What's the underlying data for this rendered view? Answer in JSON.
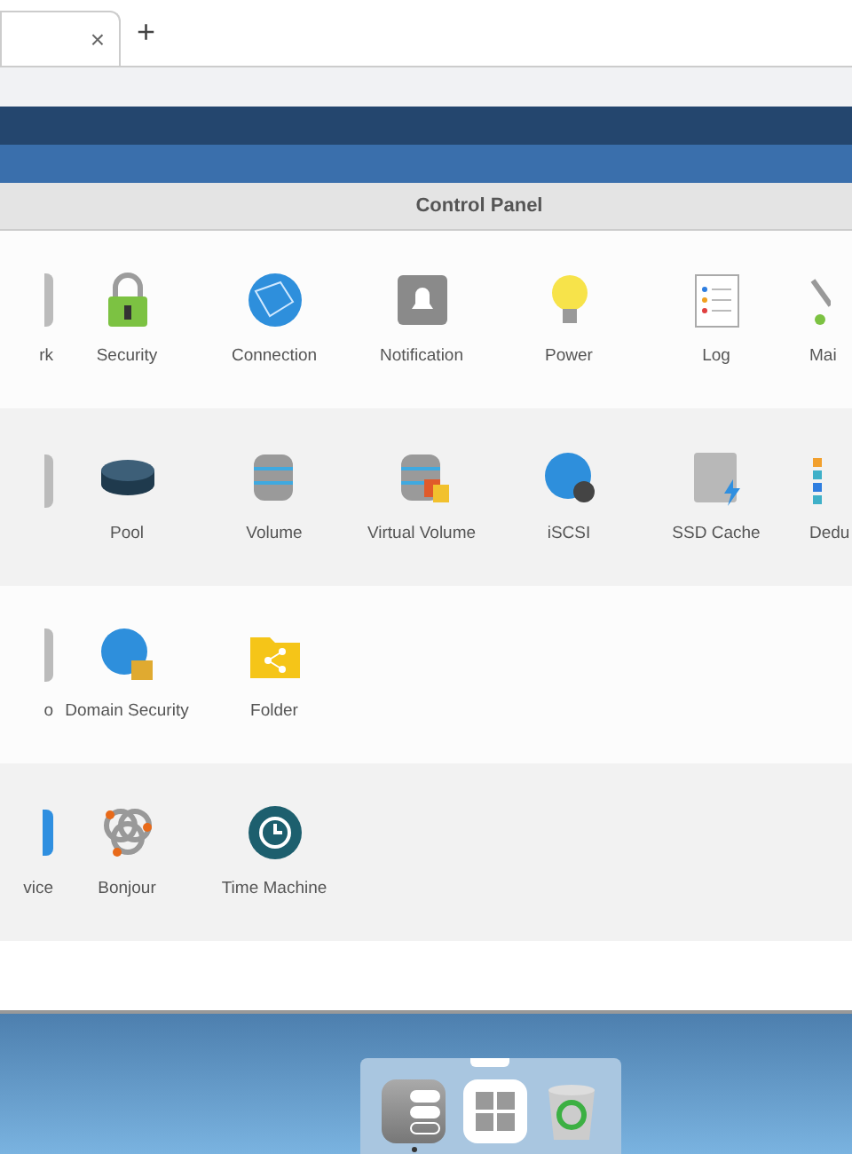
{
  "browser": {
    "tab_close": "×",
    "new_tab": "+"
  },
  "window": {
    "title": "Control Panel"
  },
  "sections": [
    {
      "items": [
        {
          "label": "rk",
          "kind": "edge"
        },
        {
          "label": "Security",
          "kind": "lock"
        },
        {
          "label": "Connection",
          "kind": "globe"
        },
        {
          "label": "Notification",
          "kind": "bell"
        },
        {
          "label": "Power",
          "kind": "bulb"
        },
        {
          "label": "Log",
          "kind": "log"
        },
        {
          "label": "Mai",
          "kind": "tool"
        }
      ]
    },
    {
      "items": [
        {
          "kind": "edge"
        },
        {
          "label": "Pool",
          "kind": "pool"
        },
        {
          "label": "Volume",
          "kind": "db"
        },
        {
          "label": "Virtual Volume",
          "kind": "vdb"
        },
        {
          "label": "iSCSI",
          "kind": "iscsi"
        },
        {
          "label": "SSD Cache",
          "kind": "ssd"
        },
        {
          "label": "Dedu",
          "kind": "dedup"
        }
      ]
    },
    {
      "items": [
        {
          "label": "o",
          "kind": "edge"
        },
        {
          "label": "Domain Security",
          "kind": "domain"
        },
        {
          "label": "Folder",
          "kind": "folder"
        }
      ]
    },
    {
      "items": [
        {
          "label": "vice",
          "kind": "edgeblue"
        },
        {
          "label": "Bonjour",
          "kind": "bonjour"
        },
        {
          "label": "Time Machine",
          "kind": "clock"
        }
      ]
    }
  ],
  "dock": [
    {
      "kind": "settings",
      "running": true
    },
    {
      "kind": "apps",
      "running": false
    },
    {
      "kind": "trash",
      "running": false
    }
  ]
}
